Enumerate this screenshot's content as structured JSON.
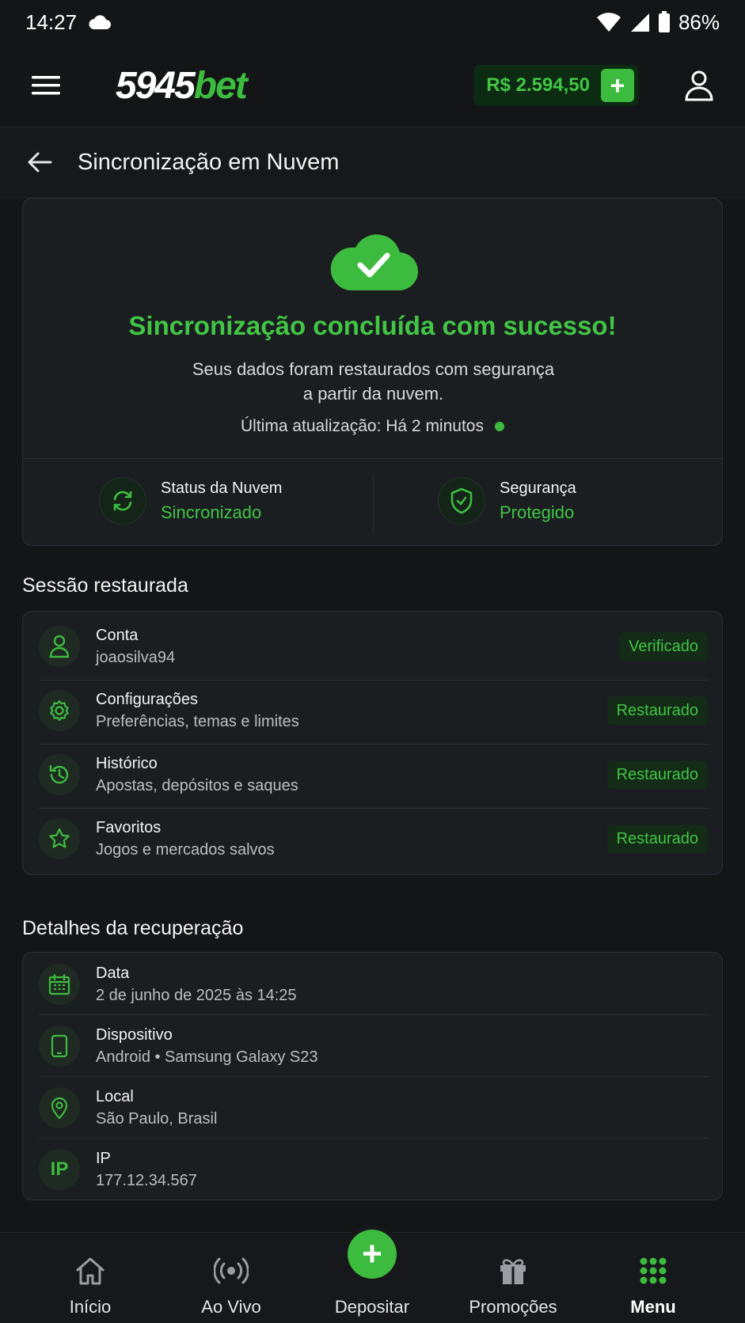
{
  "status_bar": {
    "time": "14:27",
    "battery": "86%"
  },
  "header": {
    "logo_num": "5945",
    "logo_bet": "bet",
    "balance": "R$ 2.594,50",
    "balance_plus": "+"
  },
  "page": {
    "title": "Sincronização em Nuvem"
  },
  "hero": {
    "title": "Sincronização concluída com sucesso!",
    "desc_line1": "Seus dados foram restaurados com segurança",
    "desc_line2": "a partir da nuvem.",
    "updated": "Última atualização: Há 2 minutos",
    "stats": [
      {
        "label": "Status da Nuvem",
        "value": "Sincronizado",
        "icon": "sync-icon"
      },
      {
        "label": "Segurança",
        "value": "Protegido",
        "icon": "shield-icon"
      }
    ]
  },
  "session": {
    "title": "Sessão restaurada",
    "items": [
      {
        "title": "Conta",
        "sub": "joaosilva94",
        "badge": "Verificado",
        "icon": "user-icon"
      },
      {
        "title": "Configurações",
        "sub": "Preferências, temas e limites",
        "badge": "Restaurado",
        "icon": "gear-icon"
      },
      {
        "title": "Histórico",
        "sub": "Apostas, depósitos e saques",
        "badge": "Restaurado",
        "icon": "history-icon"
      },
      {
        "title": "Favoritos",
        "sub": "Jogos e mercados salvos",
        "badge": "Restaurado",
        "icon": "star-icon"
      }
    ]
  },
  "recovery": {
    "title": "Detalhes da recuperação",
    "items": [
      {
        "title": "Data",
        "sub": "2 de junho de 2025 às 14:25",
        "icon": "calendar-icon"
      },
      {
        "title": "Dispositivo",
        "sub": "Android • Samsung Galaxy S23",
        "icon": "phone-icon"
      },
      {
        "title": "Local",
        "sub": "São Paulo, Brasil",
        "icon": "location-icon"
      },
      {
        "title": "IP",
        "sub": "177.12.34.567",
        "icon": "ip-icon",
        "icon_text": "IP"
      }
    ]
  },
  "nav": {
    "items": [
      {
        "label": "Início",
        "icon": "home-icon"
      },
      {
        "label": "Ao Vivo",
        "icon": "live-icon"
      },
      {
        "label": "Depositar",
        "icon": "plus-icon",
        "fab": "+"
      },
      {
        "label": "Promoções",
        "icon": "gift-icon"
      },
      {
        "label": "Menu",
        "icon": "grid-icon"
      }
    ]
  },
  "colors": {
    "accent": "#3dbb3f",
    "background": "#131517",
    "card": "#1b1e21"
  }
}
